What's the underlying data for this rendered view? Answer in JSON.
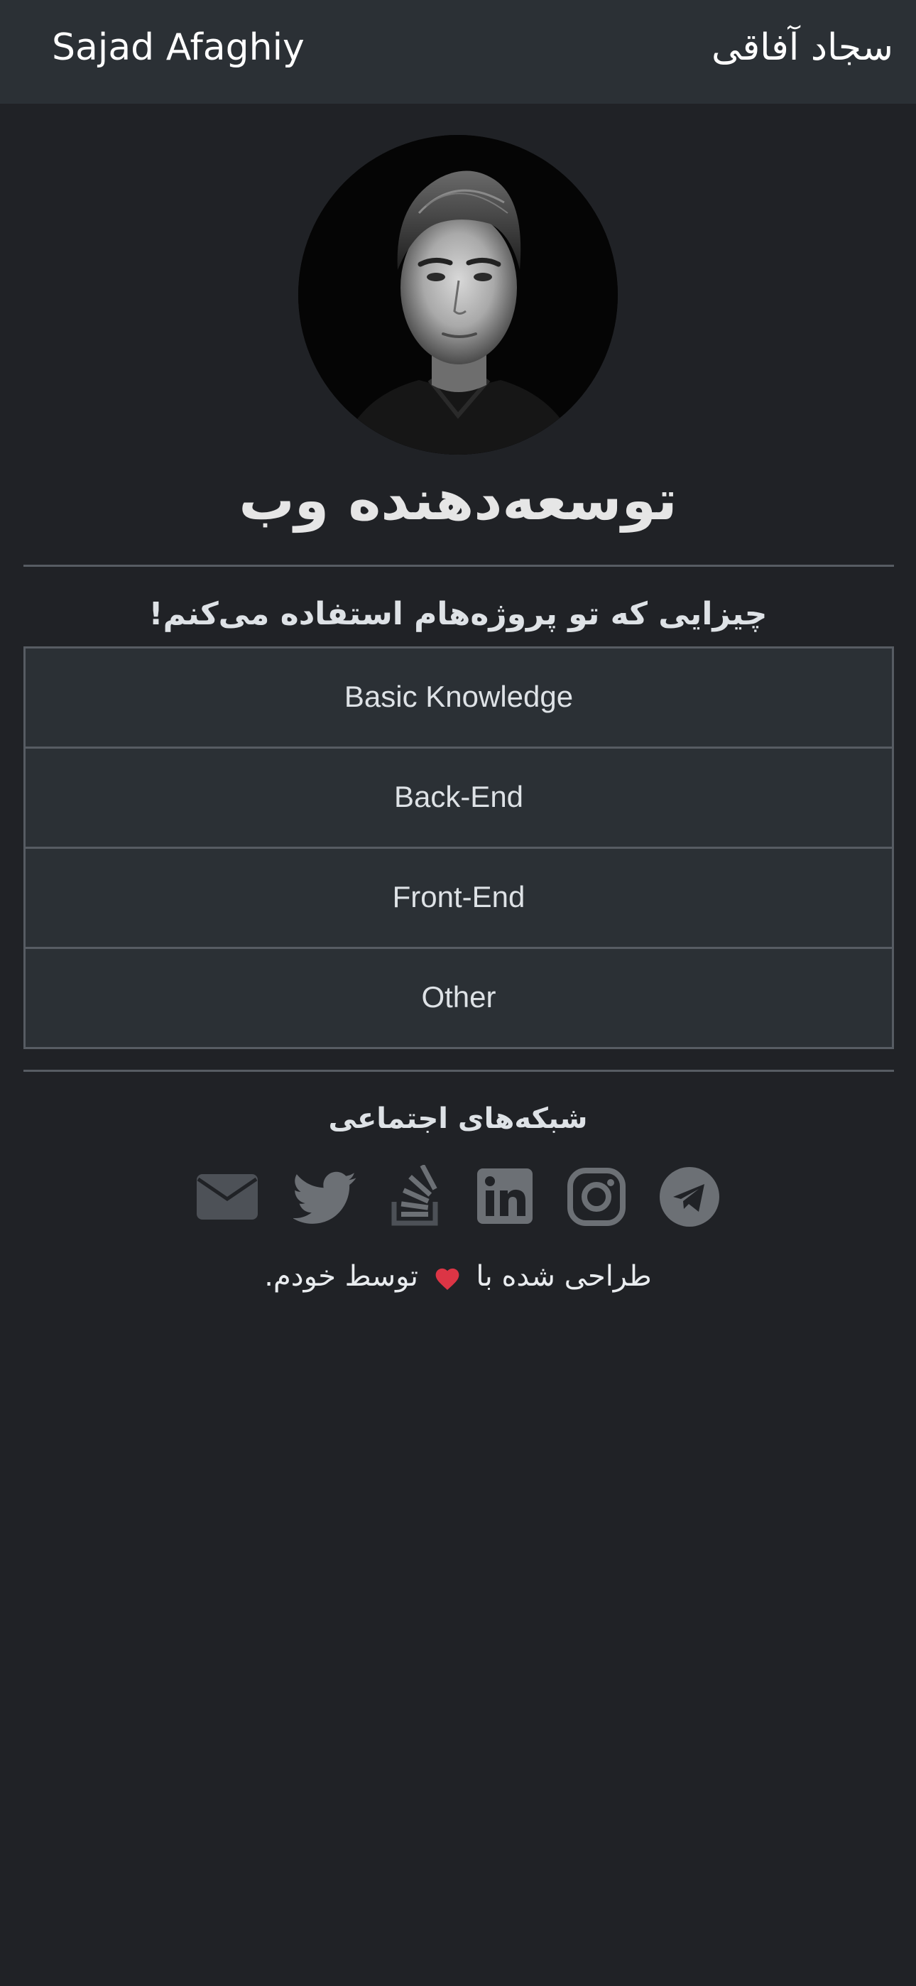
{
  "navbar": {
    "brand_en": "Sajad Afaghiy",
    "brand_fa": "سجاد آفاقی"
  },
  "profile": {
    "role_title": "توسعه‌دهنده وب"
  },
  "stack": {
    "heading": "چیزایی که تو پروژه‌هام استفاده می‌کنم!",
    "items": [
      {
        "label": "Basic Knowledge"
      },
      {
        "label": "Back-End"
      },
      {
        "label": "Front-End"
      },
      {
        "label": "Other"
      }
    ]
  },
  "social": {
    "heading": "شبکه‌های اجتماعی",
    "icons": [
      "email-icon",
      "twitter-icon",
      "stackoverflow-icon",
      "linkedin-icon",
      "instagram-icon",
      "telegram-icon"
    ],
    "icon_color": "#6c7075"
  },
  "footer": {
    "before_heart": "طراحی شده با",
    "after_heart": "توسط خودم.",
    "heart_color": "#dc3545"
  },
  "colors": {
    "background": "#202226",
    "navbar": "#2b3035",
    "border": "#575c63"
  }
}
